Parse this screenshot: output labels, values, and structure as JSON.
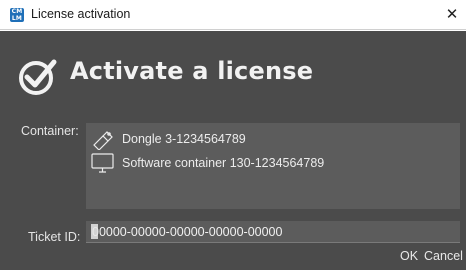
{
  "window": {
    "title": "License activation",
    "close_glyph": "✕",
    "app_icon_text": [
      "CM",
      "LM"
    ],
    "app_icon_name": "codemeter-license-icon"
  },
  "header": {
    "title": "Activate a license",
    "icon": "checkmark-circle-icon"
  },
  "container_section": {
    "label": "Container:",
    "items": [
      {
        "label": "Dongle 3-1234564789",
        "icon": "dongle-icon"
      },
      {
        "label": "Software container 130-1234564789",
        "icon": "monitor-icon"
      }
    ]
  },
  "ticket": {
    "label": "Ticket ID:",
    "value": "00000-00000-00000-00000-00000"
  },
  "buttons": {
    "ok_label": "OK",
    "cancel_label": "Cancel"
  },
  "colors": {
    "background": "#4b4b4b",
    "panel": "#5c5c5c",
    "titlebar": "#ffffff",
    "app_icon": "#1f6fb8",
    "text": "#ececec"
  }
}
